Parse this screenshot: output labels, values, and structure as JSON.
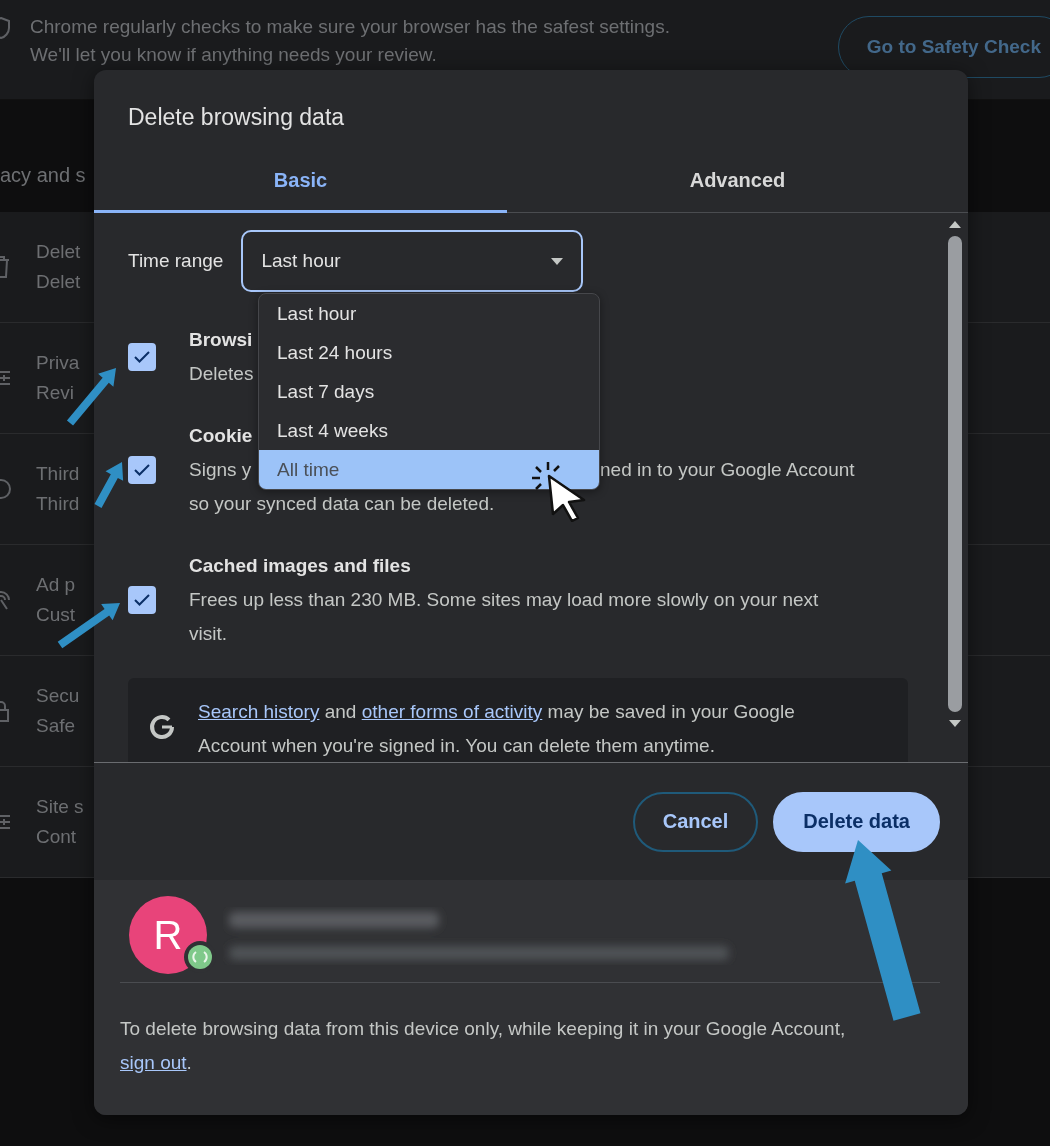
{
  "background": {
    "banner_lines": [
      "Chrome regularly checks to make sure your browser has the safest settings.",
      "We'll let you know if anything needs your review."
    ],
    "banner_button": "Go to Safety Check",
    "section_title": "acy and s",
    "rows": [
      {
        "title": "Delet",
        "subtitle": "Delet"
      },
      {
        "title": "Priva",
        "subtitle": "Revi"
      },
      {
        "title": "Third",
        "subtitle": "Third"
      },
      {
        "title": "Ad p",
        "subtitle": "Cust"
      },
      {
        "title": "Secu",
        "subtitle": "Safe"
      },
      {
        "title": "Site s",
        "subtitle": "Cont"
      }
    ]
  },
  "dialog": {
    "title": "Delete browsing data",
    "tabs": [
      {
        "label": "Basic",
        "selected": true
      },
      {
        "label": "Advanced",
        "selected": false
      }
    ],
    "time_range": {
      "label": "Time range",
      "value": "Last hour",
      "expanded": true,
      "options": [
        {
          "label": "Last hour",
          "highlighted": false
        },
        {
          "label": "Last 24 hours",
          "highlighted": false
        },
        {
          "label": "Last 7 days",
          "highlighted": false
        },
        {
          "label": "Last 4 weeks",
          "highlighted": false
        },
        {
          "label": "All time",
          "highlighted": true
        }
      ]
    },
    "rows": [
      {
        "checked": true,
        "title": [
          "Browsi"
        ],
        "lines": [
          [
            "Deletes"
          ]
        ]
      },
      {
        "checked": true,
        "title": [
          "Cookie"
        ],
        "lines": [
          [
            "Signs y",
            "ned in to your Google Account"
          ],
          [
            "so your synced data can be deleted."
          ]
        ]
      },
      {
        "checked": true,
        "title": [
          "Cached images and files"
        ],
        "lines": [
          [
            "Frees up less than 230 MB. Some sites may load more slowly on your next visit."
          ]
        ]
      }
    ],
    "notice": [
      {
        "kind": "link",
        "text": "Search history"
      },
      {
        "kind": "text",
        "text": " and "
      },
      {
        "kind": "link",
        "text": "other forms of activity"
      },
      {
        "kind": "text",
        "text": " may be saved in your Google Account when you're signed in. You can delete them anytime."
      }
    ],
    "buttons": [
      {
        "kind": "outline",
        "label": "Cancel"
      },
      {
        "kind": "primary",
        "label": "Delete data"
      }
    ],
    "account": {
      "avatar_letter": "R",
      "synced": true
    },
    "footer_note": [
      {
        "kind": "text",
        "text": "To delete browsing data from this device only, while keeping it in your Google Account, "
      },
      {
        "kind": "link",
        "text": "sign out"
      },
      {
        "kind": "text",
        "text": "."
      }
    ]
  }
}
